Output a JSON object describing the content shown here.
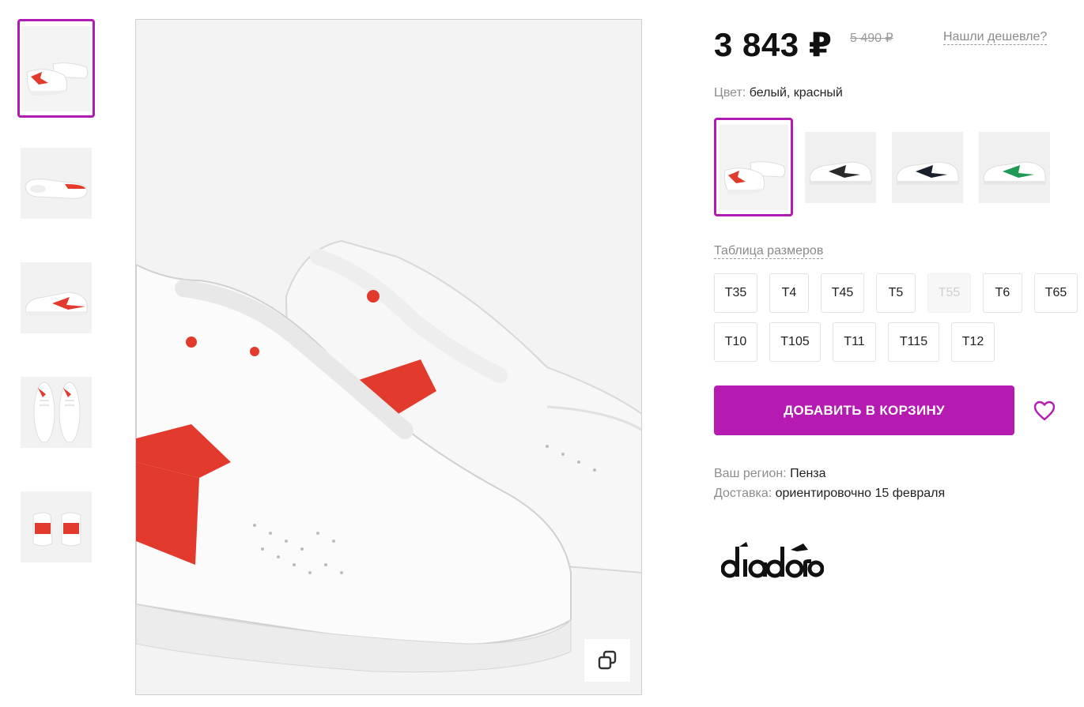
{
  "product": {
    "price": "3 843 ₽",
    "old_price": "5 490 ₽",
    "cheaper_link": "Нашли дешевле?",
    "color_label": "Цвет:",
    "color_value": "белый, красный",
    "size_table_link": "Таблица размеров",
    "add_to_cart": "ДОБАВИТЬ В КОРЗИНУ",
    "region_label": "Ваш регион:",
    "region_value": "Пенза",
    "delivery_label": "Доставка:",
    "delivery_value": "ориентировочно 15 февраля",
    "brand": "diadora"
  },
  "gallery": {
    "thumbnails": [
      {
        "view": "pair-angled",
        "selected": true
      },
      {
        "view": "sole"
      },
      {
        "view": "side"
      },
      {
        "view": "top-pair"
      },
      {
        "view": "back-pair"
      }
    ]
  },
  "color_variants": [
    {
      "accent": "#e23b2e",
      "selected": true
    },
    {
      "accent": "#2a2a2a"
    },
    {
      "accent": "#1a1f2e"
    },
    {
      "accent": "#1f9a55"
    }
  ],
  "sizes": [
    {
      "label": "Т35",
      "available": true
    },
    {
      "label": "Т4",
      "available": true
    },
    {
      "label": "Т45",
      "available": true
    },
    {
      "label": "Т5",
      "available": true
    },
    {
      "label": "Т55",
      "available": false
    },
    {
      "label": "Т6",
      "available": true
    },
    {
      "label": "Т65",
      "available": true
    },
    {
      "label": "Т10",
      "available": true
    },
    {
      "label": "Т105",
      "available": true
    },
    {
      "label": "Т11",
      "available": true
    },
    {
      "label": "Т115",
      "available": true
    },
    {
      "label": "Т12",
      "available": true
    }
  ],
  "colors": {
    "accent": "#b51bb0",
    "shoe_red": "#e23b2e"
  }
}
